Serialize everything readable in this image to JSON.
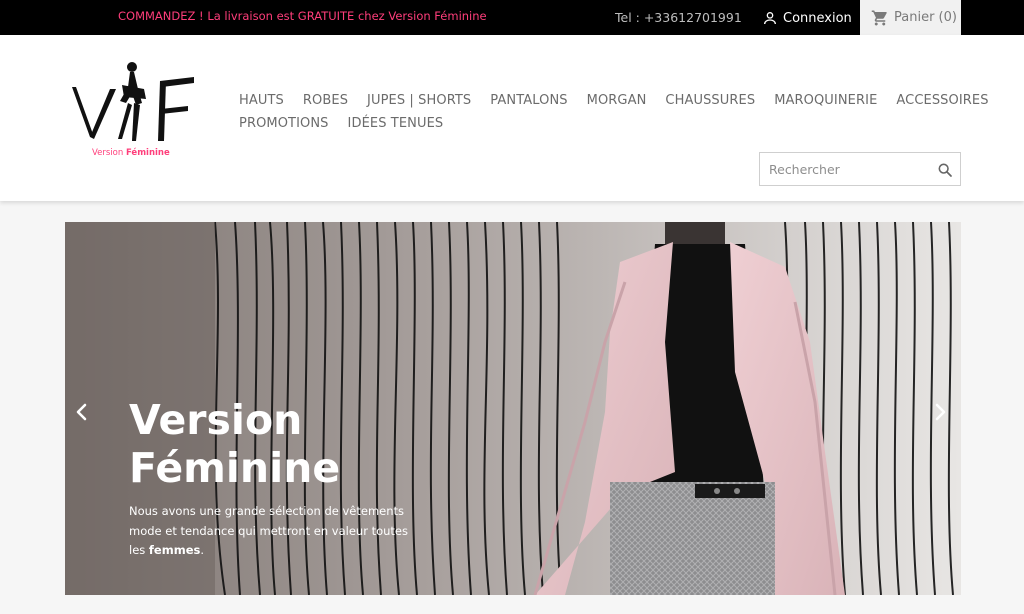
{
  "topbar": {
    "promo": "COMMANDEZ ! La livraison est GRATUITE chez Version Féminine",
    "phone": "Tel : +33612701991",
    "login_label": "Connexion",
    "cart_label": "Panier (0)",
    "icons": {
      "user": "user-icon",
      "cart": "shopping-cart-icon"
    }
  },
  "logo": {
    "letters": "VF",
    "tag_part1": "Version",
    "tag_part2": "Féminine"
  },
  "nav": {
    "row1": [
      "HAUTS",
      "ROBES",
      "JUPES | SHORTS",
      "PANTALONS",
      "MORGAN",
      "CHAUSSURES",
      "MAROQUINERIE",
      "ACCESSOIRES"
    ],
    "row2": [
      "PROMOTIONS",
      "IDÉES TENUES"
    ]
  },
  "search": {
    "placeholder": "Rechercher",
    "icon": "search-icon"
  },
  "hero": {
    "title_line1": "Version",
    "title_line2": "Féminine",
    "desc_part1": "Nous avons une grande sélection de vêtements mode et tendance qui mettront en valeur toutes les ",
    "desc_bold": "femmes",
    "desc_end": ".",
    "icons": {
      "prev": "chevron-left-icon",
      "next": "chevron-right-icon"
    }
  },
  "colors": {
    "accent_pink": "#ff3e7b",
    "topbar_bg": "#000000",
    "nav_text": "#6b6b6b"
  }
}
